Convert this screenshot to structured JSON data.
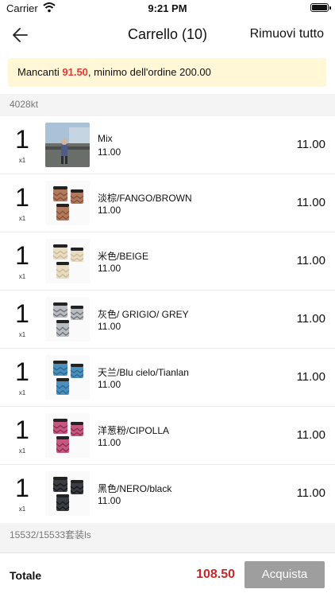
{
  "status_bar": {
    "carrier": "Carrier",
    "time": "9:21 PM"
  },
  "nav": {
    "title": "Carrello (10)",
    "remove_all": "Rimuovi tutto"
  },
  "notice": {
    "prefix": "Mancanti ",
    "amount": "91.50",
    "suffix": ", minimo dell'ordine 200.00"
  },
  "group_header": "4028kt",
  "items": [
    {
      "qty": "1",
      "mult": "x1",
      "name": "Mix",
      "price": "11.00",
      "total": "11.00",
      "thumb": "photo-person"
    },
    {
      "qty": "1",
      "mult": "x1",
      "name": "淡棕/FANGO/BROWN",
      "price": "11.00",
      "total": "11.00",
      "thumb": "bags",
      "color": "#b07a5e",
      "pattern": "#8a4f3a"
    },
    {
      "qty": "1",
      "mult": "x1",
      "name": "米色/BEIGE",
      "price": "11.00",
      "total": "11.00",
      "thumb": "bags",
      "color": "#e8dcc2",
      "pattern": "#cbb994"
    },
    {
      "qty": "1",
      "mult": "x1",
      "name": "灰色/ GRIGIO/ GREY",
      "price": "11.00",
      "total": "11.00",
      "thumb": "bags",
      "color": "#b9bcc0",
      "pattern": "#6d7176"
    },
    {
      "qty": "1",
      "mult": "x1",
      "name": "天兰/Blu cielo/Tianlan",
      "price": "11.00",
      "total": "11.00",
      "thumb": "bags",
      "color": "#4a8fbd",
      "pattern": "#2c6790"
    },
    {
      "qty": "1",
      "mult": "x1",
      "name": "洋葱粉/CIPOLLA",
      "price": "11.00",
      "total": "11.00",
      "thumb": "bags",
      "color": "#c4587e",
      "pattern": "#8d2c52"
    },
    {
      "qty": "1",
      "mult": "x1",
      "name": "黑色/NERO/black",
      "price": "11.00",
      "total": "11.00",
      "thumb": "bags",
      "color": "#3a3d44",
      "pattern": "#15171b"
    }
  ],
  "footer_group": "15532/15533套装ls",
  "bottom": {
    "label": "Totale",
    "sum": "108.50",
    "buy": "Acquista"
  }
}
